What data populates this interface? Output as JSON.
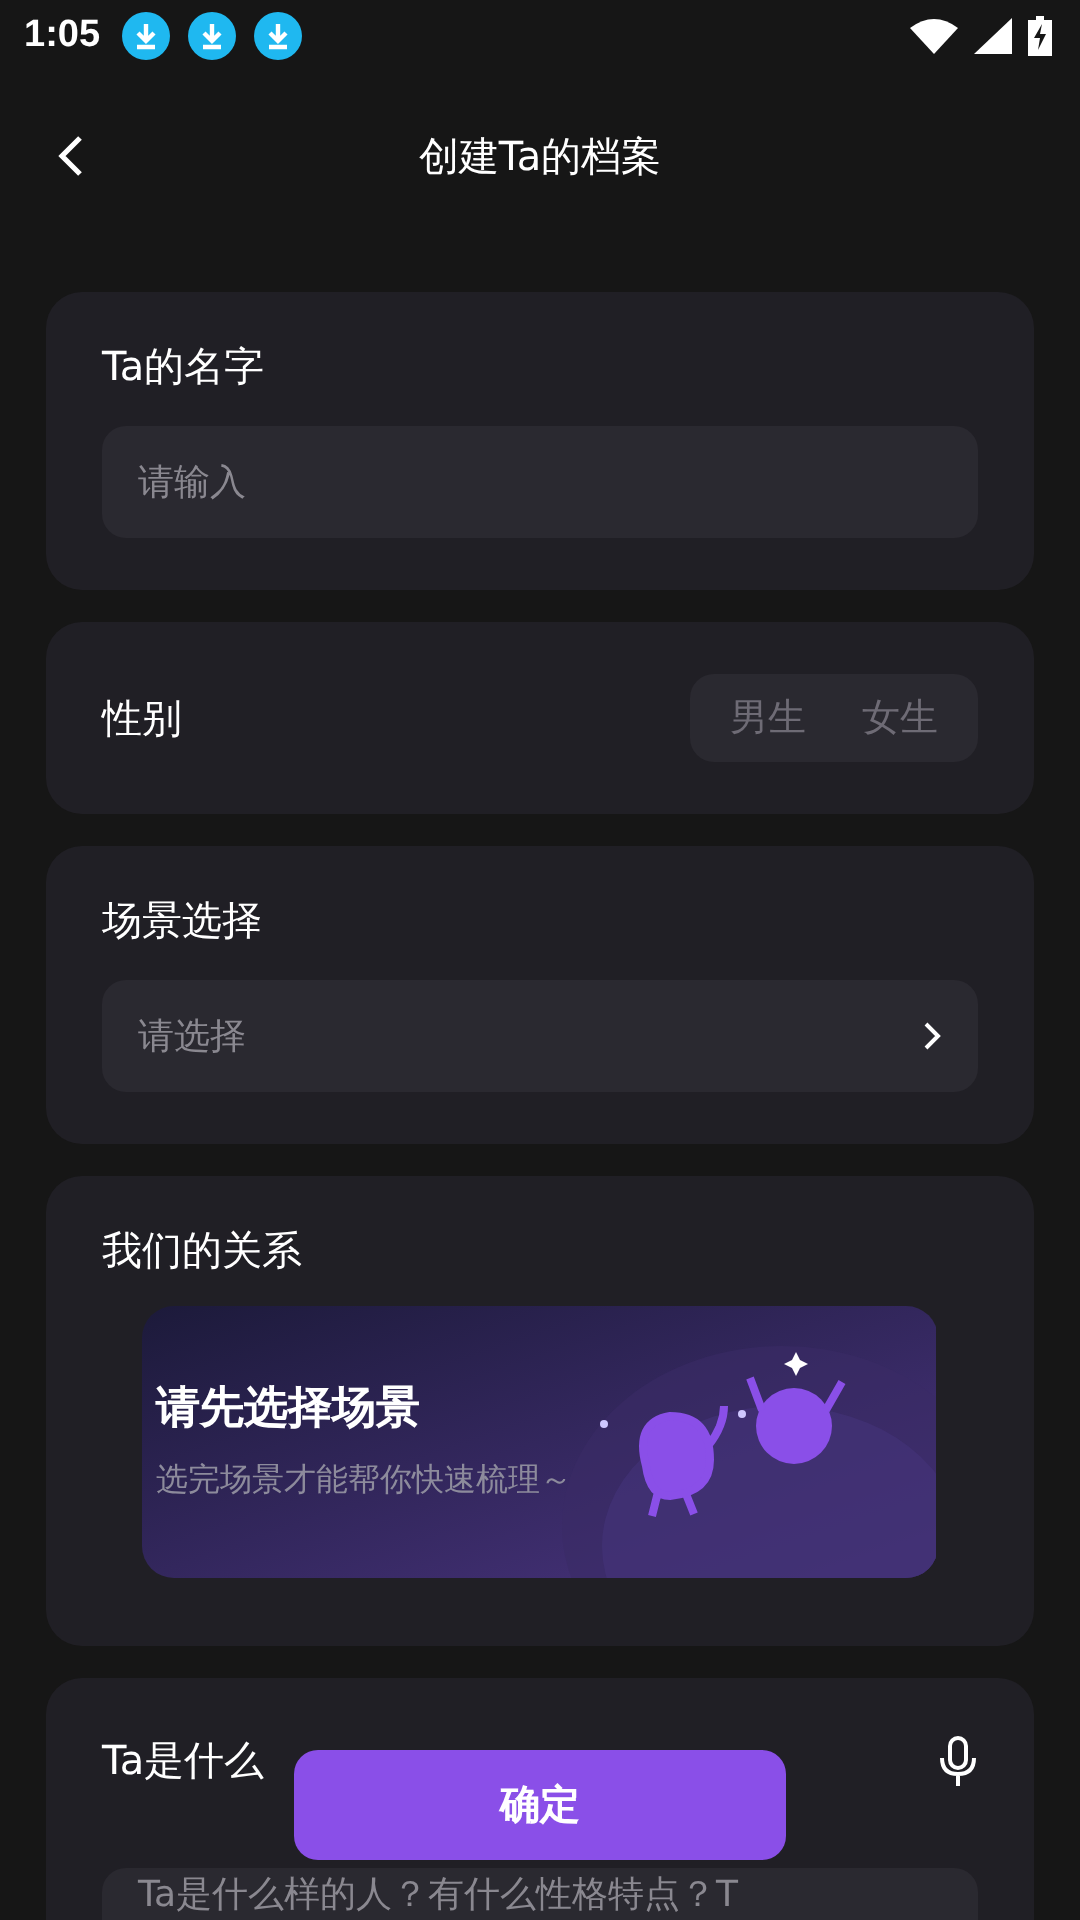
{
  "status_bar": {
    "time": "1:05",
    "notifications": [
      {
        "kind": "download"
      },
      {
        "kind": "download"
      },
      {
        "kind": "download"
      }
    ]
  },
  "header": {
    "title": "创建Ta的档案"
  },
  "name_section": {
    "label": "Ta的名字",
    "field": {
      "placeholder": "请输入"
    }
  },
  "gender_section": {
    "label": "性别",
    "options": [
      {
        "label": "男生",
        "selected": false
      },
      {
        "label": "女生",
        "selected": false
      }
    ]
  },
  "scene_section": {
    "label": "场景选择",
    "select": {
      "placeholder": "请选择"
    }
  },
  "relation_section": {
    "label": "我们的关系",
    "banner": {
      "title": "请先选择场景",
      "subtitle": "选完场景才能帮你快速梳理～"
    }
  },
  "description_section": {
    "label": "Ta是什么",
    "field": {
      "placeholder": "Ta是什么样的人？有什么性格特点？T"
    }
  },
  "confirm_button": {
    "label": "确定"
  }
}
